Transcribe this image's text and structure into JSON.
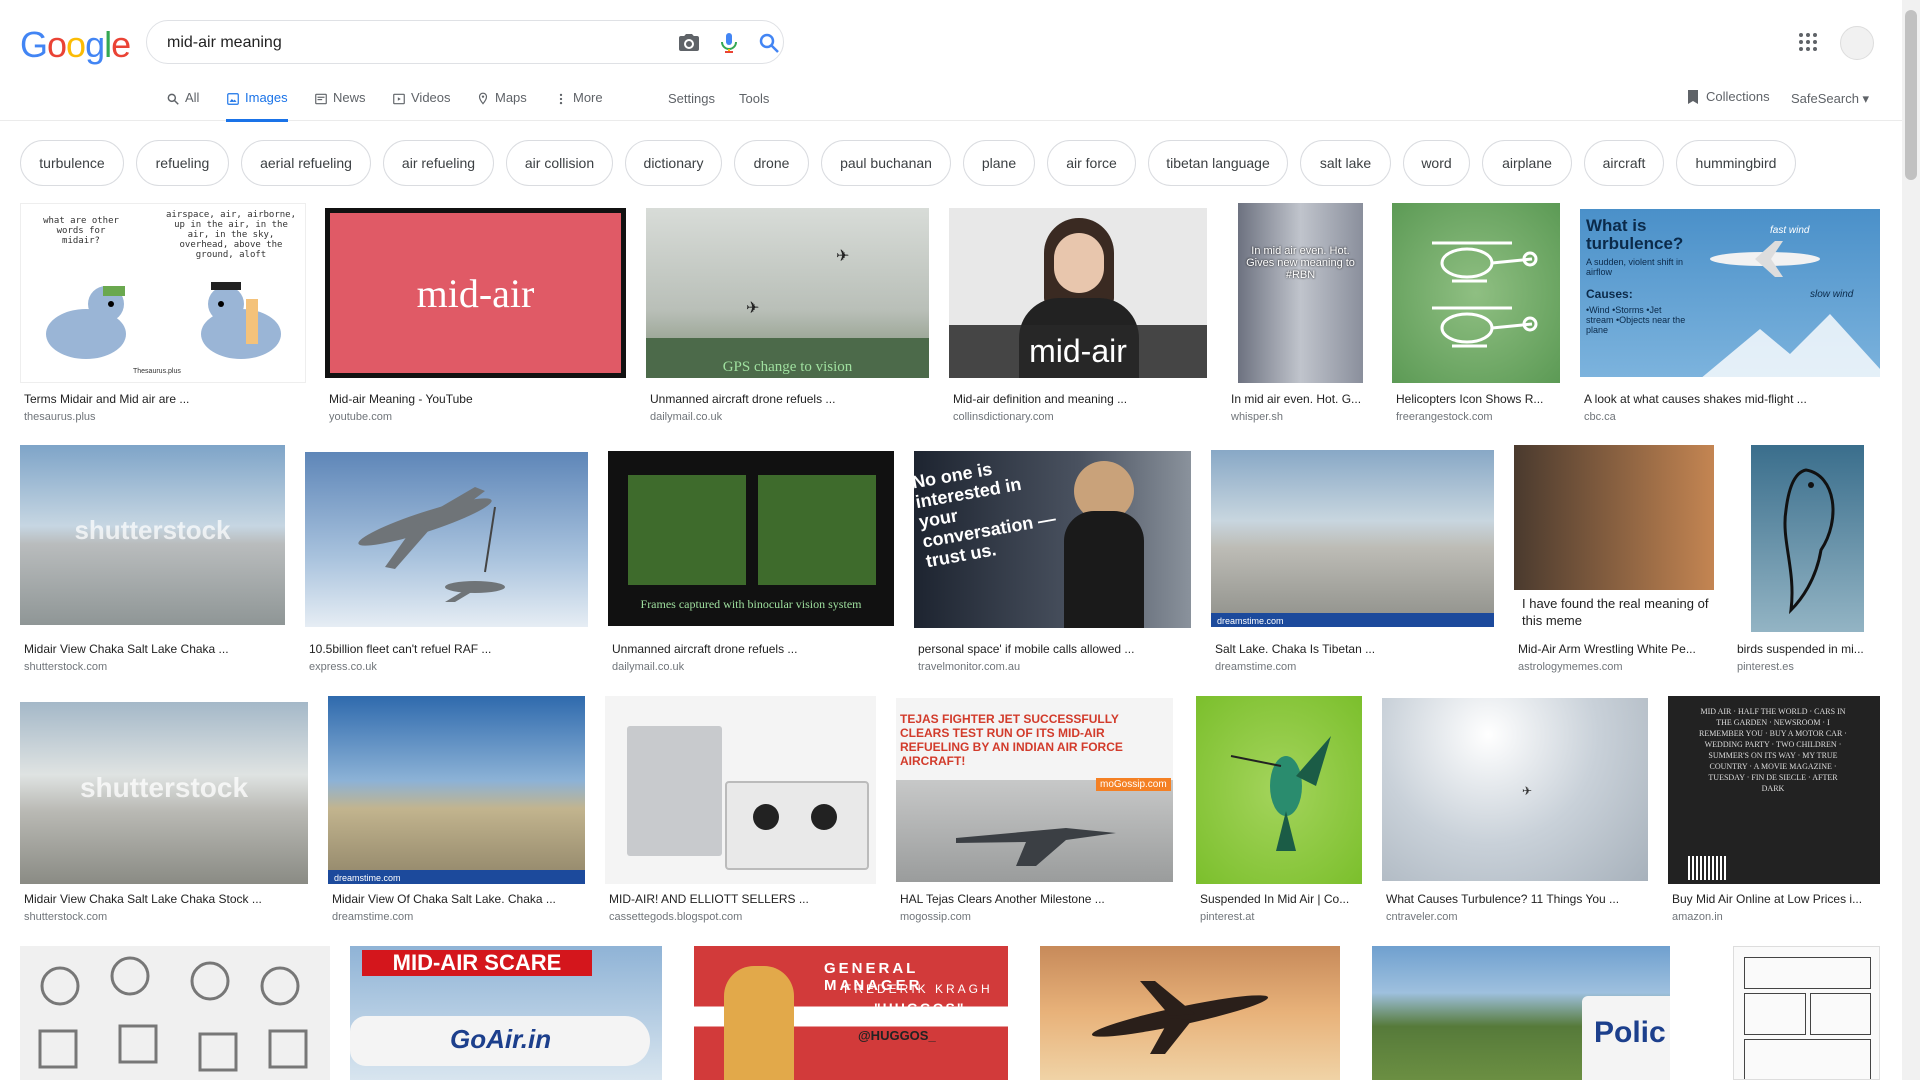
{
  "logo": {
    "letters": [
      "G",
      "o",
      "o",
      "g",
      "l",
      "e"
    ],
    "colors": [
      "#4285F4",
      "#EA4335",
      "#FBBC05",
      "#4285F4",
      "#34A853",
      "#EA4335"
    ]
  },
  "search": {
    "value": "mid-air meaning"
  },
  "tabs": [
    {
      "label": "All",
      "icon": "search-icon"
    },
    {
      "label": "Images",
      "icon": "image-icon"
    },
    {
      "label": "News",
      "icon": "news-icon"
    },
    {
      "label": "Videos",
      "icon": "video-icon"
    },
    {
      "label": "Maps",
      "icon": "map-icon"
    },
    {
      "label": "More",
      "icon": "more-icon"
    }
  ],
  "tools": {
    "settings": "Settings",
    "tools": "Tools",
    "collections": "Collections",
    "safesearch": "SafeSearch"
  },
  "chips": [
    "turbulence",
    "refueling",
    "aerial refueling",
    "air refueling",
    "air collision",
    "dictionary",
    "drone",
    "paul buchanan",
    "plane",
    "air force",
    "tibetan language",
    "salt lake",
    "word",
    "airplane",
    "aircraft",
    "hummingbird"
  ],
  "results": [
    {
      "title": "Terms Midair and Mid air are ...",
      "source": "thesaurus.plus"
    },
    {
      "title": "Mid-air Meaning - YouTube",
      "source": "youtube.com"
    },
    {
      "title": "Unmanned aircraft drone refuels ...",
      "source": "dailymail.co.uk"
    },
    {
      "title": "Mid-air definition and meaning ...",
      "source": "collinsdictionary.com"
    },
    {
      "title": "In mid air even. Hot. G...",
      "source": "whisper.sh"
    },
    {
      "title": "Helicopters Icon Shows R...",
      "source": "freerangestock.com"
    },
    {
      "title": "A look at what causes shakes mid-flight ...",
      "source": "cbc.ca"
    },
    {
      "title": "Midair View Chaka Salt Lake Chaka ...",
      "source": "shutterstock.com"
    },
    {
      "title": "10.5billion fleet can't refuel RAF ...",
      "source": "express.co.uk"
    },
    {
      "title": "Unmanned aircraft drone refuels ...",
      "source": "dailymail.co.uk"
    },
    {
      "title": "personal space' if mobile calls allowed ...",
      "source": "travelmonitor.com.au"
    },
    {
      "title": "Salt Lake. Chaka Is Tibetan ...",
      "source": "dreamstime.com"
    },
    {
      "title": "Mid-Air Arm Wrestling White Pe...",
      "source": "astrologymemes.com"
    },
    {
      "title": "birds suspended in mi...",
      "source": "pinterest.es"
    },
    {
      "title": "Midair View Chaka Salt Lake Chaka Stock ...",
      "source": "shutterstock.com"
    },
    {
      "title": "Midair View Of Chaka Salt Lake. Chaka ...",
      "source": "dreamstime.com"
    },
    {
      "title": "MID-AIR! AND ELLIOTT SELLERS ...",
      "source": "cassettegods.blogspot.com"
    },
    {
      "title": "HAL Tejas Clears Another Milestone ...",
      "source": "mogossip.com"
    },
    {
      "title": "Suspended In Mid Air | Co...",
      "source": "pinterest.at"
    },
    {
      "title": "What Causes Turbulence? 11 Things You ...",
      "source": "cntraveler.com"
    },
    {
      "title": "Buy Mid Air Online at Low Prices i...",
      "source": "amazon.in"
    }
  ],
  "thumb_texts": {
    "youtube": "mid-air",
    "collins": "mid-air",
    "drone_caption": "GPS change to vision",
    "whisper": "In mid air even. Hot. Gives new meaning to #RBN",
    "cbc_title": "What is turbulence?",
    "cbc_sub": "A sudden, violent shift in airflow",
    "cbc_causes": "Causes:",
    "cbc_list": "•Wind •Storms •Jet stream •Objects near the plane",
    "cbc_fast": "fast wind",
    "cbc_slow": "slow wind",
    "pigeon_left": "what are other words for midair?",
    "pigeon_right": "airspace, air, airborne, up in the air, in the air, in the sky, overhead, above the ground, aloft",
    "thesaurus_mark": "Thesaurus.plus",
    "shutterstock": "shutterstock",
    "frames": "Frames captured with binocular vision system",
    "noone": "No one is interested in your conversation — trust us.",
    "meme": "I have found the real meaning of this meme",
    "dreamstime": "dreamstime.com",
    "tejas": "TEJAS FIGHTER JET SUCCESSFULLY CLEARS TEST RUN OF ITS MID-AIR REFUELING BY AN INDIAN AIR FORCE AIRCRAFT!",
    "mogossip": "moGossip.com",
    "midair_scare": "MID-AIR SCARE",
    "goair": "GoAir.in",
    "gm1": "GENERAL MANAGER",
    "gm2": "FREDERIK KRAGH",
    "gm3": "\"HUGGOS\"",
    "gm4": "@HUGGOS_",
    "police": "Polic",
    "book": "MID AIR · HALF THE WORLD · CARS IN THE GARDEN · NEWSROOM · I REMEMBER YOU · BUY A MOTOR CAR · WEDDING PARTY · TWO CHILDREN · SUMMER'S ON ITS WAY · MY TRUE COUNTRY · A MOVIE MAGAZINE · TUESDAY · FIN DE SIECLE · AFTER DARK"
  }
}
